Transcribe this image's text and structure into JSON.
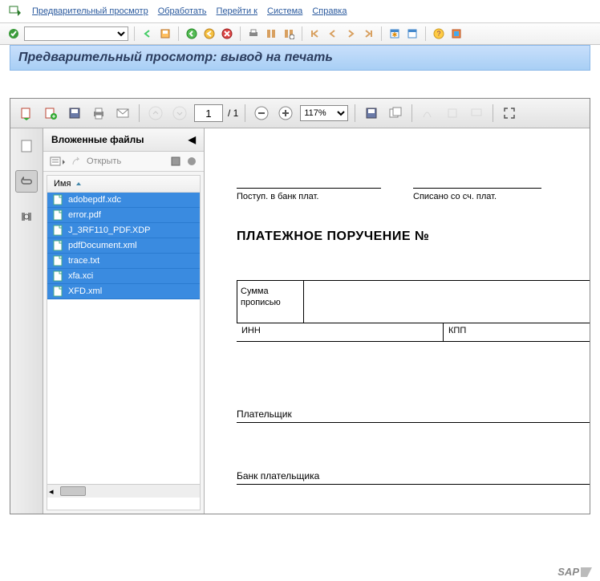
{
  "menu": {
    "items": [
      "Предварительный просмотр",
      "Обработать",
      "Перейти к",
      "Система",
      "Справка"
    ]
  },
  "title": "Предварительный просмотр: вывод на печать",
  "pdf_toolbar": {
    "page_current": "1",
    "page_total": "/ 1",
    "zoom": "117%"
  },
  "attachments": {
    "header": "Вложенные файлы",
    "open_label": "Открыть",
    "col_name": "Имя",
    "files": [
      "adobepdf.xdc",
      "error.pdf",
      "J_3RF110_PDF.XDP",
      "pdfDocument.xml",
      "trace.txt",
      "xfa.xci",
      "XFD.xml"
    ]
  },
  "doc": {
    "bank_in": "Поступ. в банк плат.",
    "written_off": "Списано со сч. плат.",
    "title": "ПЛАТЕЖНОЕ ПОРУЧЕНИЕ №",
    "sum_words1": "Сумма",
    "sum_words2": "прописью",
    "inn": "ИНН",
    "kpp": "КПП",
    "payer": "Плательщик",
    "payer_bank": "Банк плательщика"
  },
  "footer_brand": "SAP"
}
